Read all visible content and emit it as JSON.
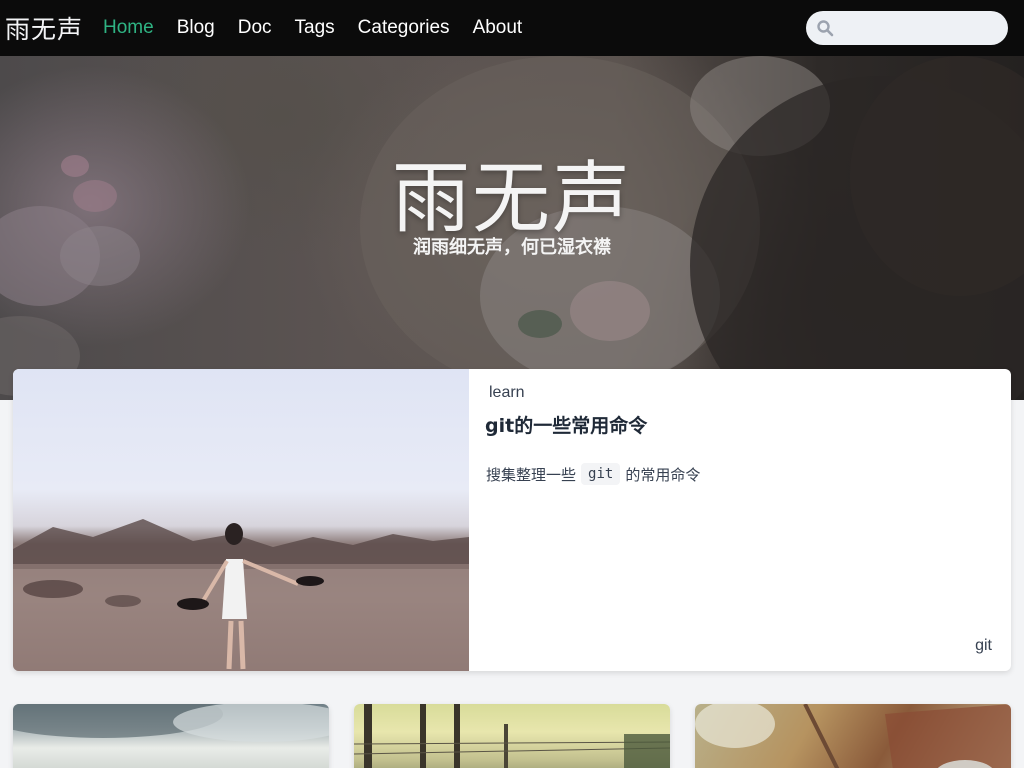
{
  "nav": {
    "brand": "雨无声",
    "links": [
      "Home",
      "Blog",
      "Doc",
      "Tags",
      "Categories",
      "About"
    ],
    "active": "Home",
    "search_placeholder": ""
  },
  "hero": {
    "title": "雨无声",
    "subtitle": "润雨细无声，何已湿衣襟"
  },
  "featured": {
    "category": "learn",
    "title": "git的一些常用命令",
    "summary_before": "搜集整理一些",
    "summary_code": "git",
    "summary_after": "的常用命令",
    "tag": "git"
  },
  "colors": {
    "nav_bg": "#0b0b0b",
    "accent": "#2fb383",
    "page_bg": "#f3f4f6"
  },
  "icons": {
    "search": "search-icon"
  }
}
